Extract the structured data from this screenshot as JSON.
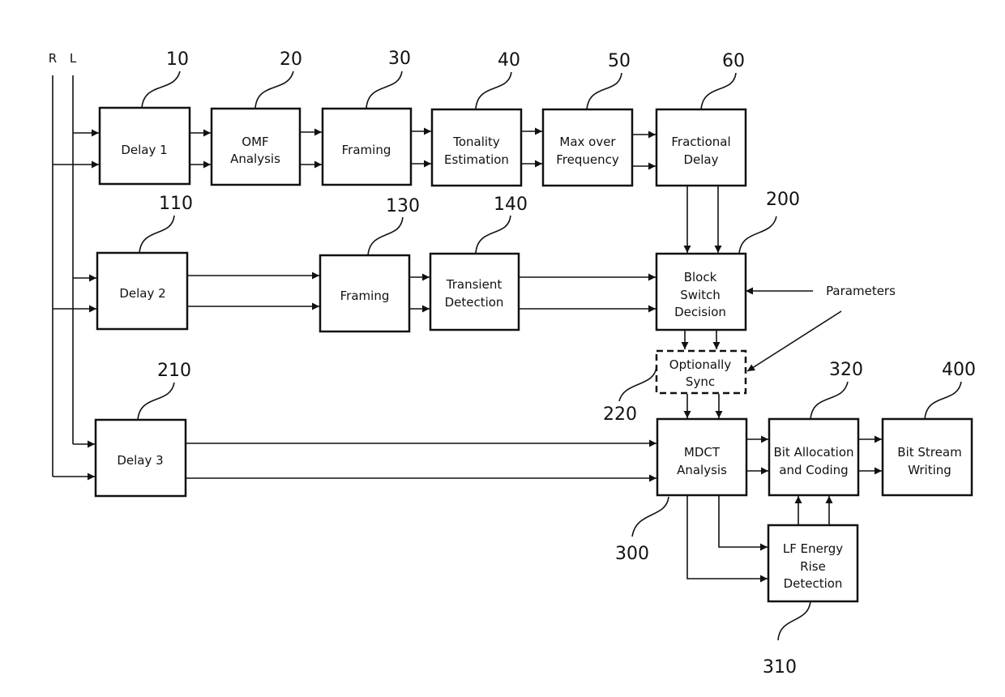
{
  "inputs": {
    "right": "R",
    "left": "L"
  },
  "blocks": {
    "b10": {
      "ref": "10",
      "lines": [
        "Delay 1"
      ]
    },
    "b20": {
      "ref": "20",
      "lines": [
        "OMF",
        "Analysis"
      ]
    },
    "b30": {
      "ref": "30",
      "lines": [
        "Framing"
      ]
    },
    "b40": {
      "ref": "40",
      "lines": [
        "Tonality",
        "Estimation"
      ]
    },
    "b50": {
      "ref": "50",
      "lines": [
        "Max over",
        "Frequency"
      ]
    },
    "b60": {
      "ref": "60",
      "lines": [
        "Fractional",
        "Delay"
      ]
    },
    "b110": {
      "ref": "110",
      "lines": [
        "Delay 2"
      ]
    },
    "b130": {
      "ref": "130",
      "lines": [
        "Framing"
      ]
    },
    "b140": {
      "ref": "140",
      "lines": [
        "Transient",
        "Detection"
      ]
    },
    "b200": {
      "ref": "200",
      "lines": [
        "Block",
        "Switch",
        "Decision"
      ]
    },
    "b220": {
      "ref": "220",
      "lines": [
        "Optionally",
        "Sync"
      ]
    },
    "b210": {
      "ref": "210",
      "lines": [
        "Delay 3"
      ]
    },
    "b300": {
      "ref": "300",
      "lines": [
        "MDCT",
        "Analysis"
      ]
    },
    "b320": {
      "ref": "320",
      "lines": [
        "Bit Allocation",
        "and Coding"
      ]
    },
    "b400": {
      "ref": "400",
      "lines": [
        "Bit Stream",
        "Writing"
      ]
    },
    "b310": {
      "ref": "310",
      "lines": [
        "LF Energy",
        "Rise",
        "Detection"
      ]
    }
  },
  "parameters_label": "Parameters"
}
